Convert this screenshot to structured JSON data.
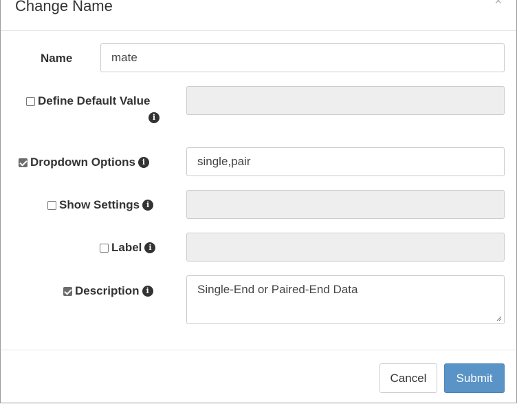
{
  "dialog": {
    "title": "Change Name",
    "close_symbol": "×"
  },
  "fields": {
    "name": {
      "label": "Name",
      "value": "mate"
    },
    "default_value": {
      "label": "Define Default Value",
      "checked": false,
      "value": ""
    },
    "dropdown_options": {
      "label": "Dropdown Options",
      "checked": true,
      "value": "single,pair"
    },
    "show_settings": {
      "label": "Show Settings",
      "checked": false,
      "value": ""
    },
    "label": {
      "label": "Label",
      "checked": false,
      "value": ""
    },
    "description": {
      "label": "Description",
      "checked": true,
      "value": "Single-End or Paired-End Data"
    }
  },
  "info_icon_glyph": "i",
  "footer": {
    "cancel_label": "Cancel",
    "submit_label": "Submit"
  },
  "colors": {
    "submit_bg": "#5a93c6",
    "disabled_field_bg": "#eeeeee"
  }
}
